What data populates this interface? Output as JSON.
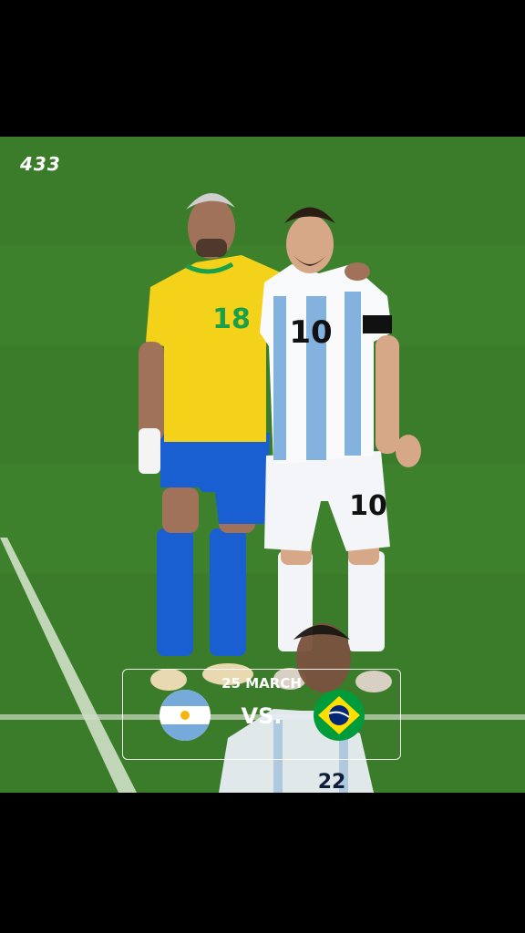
{
  "post": {
    "brand": "433",
    "date": "25 MARCH",
    "vs_label": "VS.",
    "home_team_flag": "argentina-flag-icon",
    "away_team_flag": "brazil-flag-icon"
  },
  "players": {
    "left_jersey_number": "18",
    "right_jersey_number": "10",
    "right_shorts_number": "10",
    "front_jersey_number": "22"
  },
  "colors": {
    "background": "#000000",
    "pitch": "#3a7a2a",
    "brazil_yellow": "#f5d21a",
    "brazil_blue": "#1a5fd1",
    "argentina_sky": "#75aadb",
    "white": "#ffffff"
  }
}
